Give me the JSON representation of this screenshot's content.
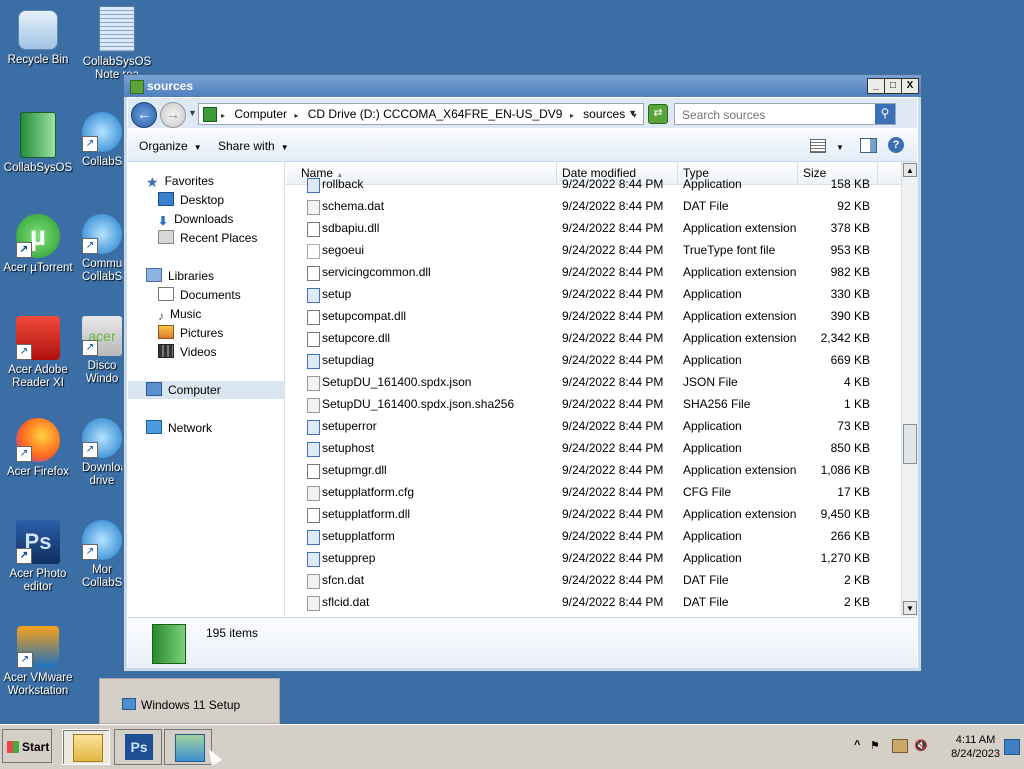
{
  "desktop": {
    "icons": [
      {
        "label": "Recycle Bin"
      },
      {
        "label": "CollabSysOS Note rea"
      },
      {
        "label": "CollabSysOS"
      },
      {
        "label": "CollabS"
      },
      {
        "label": "Acer µTorrent"
      },
      {
        "label": "Commu CollabS"
      },
      {
        "label": "Acer Adobe Reader XI"
      },
      {
        "label": "Disco Windo"
      },
      {
        "label": "Acer Firefox"
      },
      {
        "label": "Downloa drive"
      },
      {
        "label": "Acer Photo editor"
      },
      {
        "label": "Mor CollabS"
      },
      {
        "label": "Acer VMware Workstation"
      }
    ]
  },
  "window": {
    "title": "sources",
    "controls": {
      "minimize": "_",
      "maximize": "□",
      "close": "X"
    },
    "address": {
      "crumbs": [
        "Computer",
        "CD Drive (D:) CCCOMA_X64FRE_EN-US_DV9",
        "sources"
      ]
    },
    "search": {
      "placeholder": "Search sources"
    },
    "toolbar": {
      "organize": "Organize",
      "share_with": "Share with"
    },
    "nav": {
      "favorites": "Favorites",
      "desktop": "Desktop",
      "downloads": "Downloads",
      "recent_places": "Recent Places",
      "libraries": "Libraries",
      "documents": "Documents",
      "music": "Music",
      "pictures": "Pictures",
      "videos": "Videos",
      "computer": "Computer",
      "network": "Network"
    },
    "columns": {
      "name": "Name",
      "date": "Date modified",
      "type": "Type",
      "size": "Size"
    },
    "files": [
      {
        "name": "rollback",
        "date": "9/24/2022 8:44 PM",
        "type": "Application",
        "size": "158 KB",
        "icon": "app"
      },
      {
        "name": "schema.dat",
        "date": "9/24/2022 8:44 PM",
        "type": "DAT File",
        "size": "92 KB",
        "icon": "dat"
      },
      {
        "name": "sdbapiu.dll",
        "date": "9/24/2022 8:44 PM",
        "type": "Application extension",
        "size": "378 KB",
        "icon": "dll"
      },
      {
        "name": "segoeui",
        "date": "9/24/2022 8:44 PM",
        "type": "TrueType font file",
        "size": "953 KB",
        "icon": "font"
      },
      {
        "name": "servicingcommon.dll",
        "date": "9/24/2022 8:44 PM",
        "type": "Application extension",
        "size": "982 KB",
        "icon": "dll"
      },
      {
        "name": "setup",
        "date": "9/24/2022 8:44 PM",
        "type": "Application",
        "size": "330 KB",
        "icon": "app"
      },
      {
        "name": "setupcompat.dll",
        "date": "9/24/2022 8:44 PM",
        "type": "Application extension",
        "size": "390 KB",
        "icon": "dll"
      },
      {
        "name": "setupcore.dll",
        "date": "9/24/2022 8:44 PM",
        "type": "Application extension",
        "size": "2,342 KB",
        "icon": "dll"
      },
      {
        "name": "setupdiag",
        "date": "9/24/2022 8:44 PM",
        "type": "Application",
        "size": "669 KB",
        "icon": "app"
      },
      {
        "name": "SetupDU_161400.spdx.json",
        "date": "9/24/2022 8:44 PM",
        "type": "JSON File",
        "size": "4 KB",
        "icon": "dat"
      },
      {
        "name": "SetupDU_161400.spdx.json.sha256",
        "date": "9/24/2022 8:44 PM",
        "type": "SHA256 File",
        "size": "1 KB",
        "icon": "dat"
      },
      {
        "name": "setuperror",
        "date": "9/24/2022 8:44 PM",
        "type": "Application",
        "size": "73 KB",
        "icon": "app"
      },
      {
        "name": "setuphost",
        "date": "9/24/2022 8:44 PM",
        "type": "Application",
        "size": "850 KB",
        "icon": "app"
      },
      {
        "name": "setupmgr.dll",
        "date": "9/24/2022 8:44 PM",
        "type": "Application extension",
        "size": "1,086 KB",
        "icon": "dll"
      },
      {
        "name": "setupplatform.cfg",
        "date": "9/24/2022 8:44 PM",
        "type": "CFG File",
        "size": "17 KB",
        "icon": "dat"
      },
      {
        "name": "setupplatform.dll",
        "date": "9/24/2022 8:44 PM",
        "type": "Application extension",
        "size": "9,450 KB",
        "icon": "dll"
      },
      {
        "name": "setupplatform",
        "date": "9/24/2022 8:44 PM",
        "type": "Application",
        "size": "266 KB",
        "icon": "app"
      },
      {
        "name": "setupprep",
        "date": "9/24/2022 8:44 PM",
        "type": "Application",
        "size": "1,270 KB",
        "icon": "app"
      },
      {
        "name": "sfcn.dat",
        "date": "9/24/2022 8:44 PM",
        "type": "DAT File",
        "size": "2 KB",
        "icon": "dat"
      },
      {
        "name": "sflcid.dat",
        "date": "9/24/2022 8:44 PM",
        "type": "DAT File",
        "size": "2 KB",
        "icon": "dat"
      }
    ],
    "status": {
      "item_count": "195 items"
    }
  },
  "popup": {
    "label": "Windows 11 Setup"
  },
  "taskbar": {
    "start": "Start",
    "tray_up": "^",
    "clock_time": "4:11 AM",
    "clock_date": "8/24/2023"
  }
}
